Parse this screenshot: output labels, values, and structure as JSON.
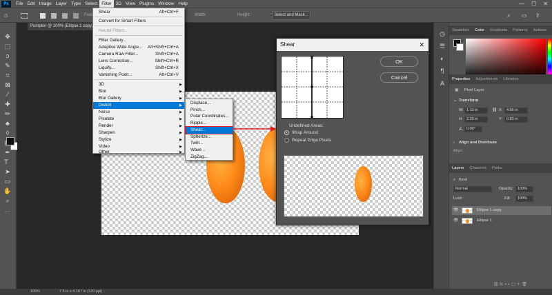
{
  "menubar": {
    "items": [
      "File",
      "Edit",
      "Image",
      "Layer",
      "Type",
      "Select",
      "Filter",
      "3D",
      "View",
      "Plugins",
      "Window",
      "Help"
    ],
    "active": "Filter",
    "window_controls": [
      "—",
      "☐",
      "✕"
    ]
  },
  "options": {
    "feather_label": "Feat",
    "width_label": "Width:",
    "height_label": "Height:",
    "select_mask": "Select and Mask..."
  },
  "document": {
    "tab_title": "Pumpkin @ 100% (Ellipse 1 copy,",
    "zoom": "100%",
    "doc_info": "7.5 in x 4.167 in (120 ppi)"
  },
  "filter_menu": {
    "items": [
      {
        "label": "Shear",
        "shortcut": "Alt+Ctrl+F"
      },
      {
        "label": "Convert for Smart Filters"
      },
      {
        "label": "Neural Filters...",
        "disabled": true
      },
      {
        "label": "Filter Gallery..."
      },
      {
        "label": "Adaptive Wide Angle...",
        "shortcut": "Alt+Shift+Ctrl+A"
      },
      {
        "label": "Camera Raw Filter...",
        "shortcut": "Shift+Ctrl+A"
      },
      {
        "label": "Lens Correction...",
        "shortcut": "Shift+Ctrl+R"
      },
      {
        "label": "Liquify...",
        "shortcut": "Shift+Ctrl+X"
      },
      {
        "label": "Vanishing Point...",
        "shortcut": "Alt+Ctrl+V"
      },
      {
        "label": "3D"
      },
      {
        "label": "Blur"
      },
      {
        "label": "Blur Gallery"
      },
      {
        "label": "Distort",
        "highlighted": true
      },
      {
        "label": "Noise"
      },
      {
        "label": "Pixelate"
      },
      {
        "label": "Render"
      },
      {
        "label": "Sharpen"
      },
      {
        "label": "Stylize"
      },
      {
        "label": "Video"
      },
      {
        "label": "Other"
      }
    ]
  },
  "distort_submenu": {
    "items": [
      "Displace...",
      "Pinch...",
      "Polar Coordinates...",
      "Ripple...",
      "Shear...",
      "Spherize...",
      "Twirl...",
      "Wave...",
      "ZigZag..."
    ],
    "selected": "Shear..."
  },
  "shear_dialog": {
    "title": "Shear",
    "close": "✕",
    "ok": "OK",
    "cancel": "Cancel",
    "undefined_areas_label": "Undefined Areas:",
    "option_wrap": "Wrap Around",
    "option_repeat": "Repeat Edge Pixels",
    "selected_option": "Wrap Around"
  },
  "right_panel": {
    "color_tabs": [
      "Swatches",
      "Color",
      "Gradients",
      "Patterns",
      "Actions"
    ],
    "active_color_tab": "Color",
    "prop_tabs": [
      "Properties",
      "Adjustments",
      "Libraries"
    ],
    "pixel_layer": "Pixel Layer",
    "transform": "Transform",
    "w_label": "W",
    "w_value": "1.13 in",
    "x_label": "X",
    "x_value": "4.55 in",
    "h_label": "H",
    "h_value": "2.29 in",
    "y_label": "Y",
    "y_value": "0.83 in",
    "angle": "0.00°",
    "align_distribute": "Align and Distribute",
    "align": "Align:",
    "layer_tabs": [
      "Layers",
      "Channels",
      "Paths"
    ],
    "kind": "Kind",
    "blend_mode": "Normal",
    "opacity_label": "Opacity:",
    "opacity": "100%",
    "lock_label": "Lock:",
    "fill_label": "Fill:",
    "fill": "100%",
    "layers": [
      "Ellipse 1 copy",
      "Ellipse 1"
    ]
  },
  "colors": {
    "accent": "#0078d7",
    "highlight_outline": "#e02020",
    "pumpkin": "#ff8c1a"
  }
}
